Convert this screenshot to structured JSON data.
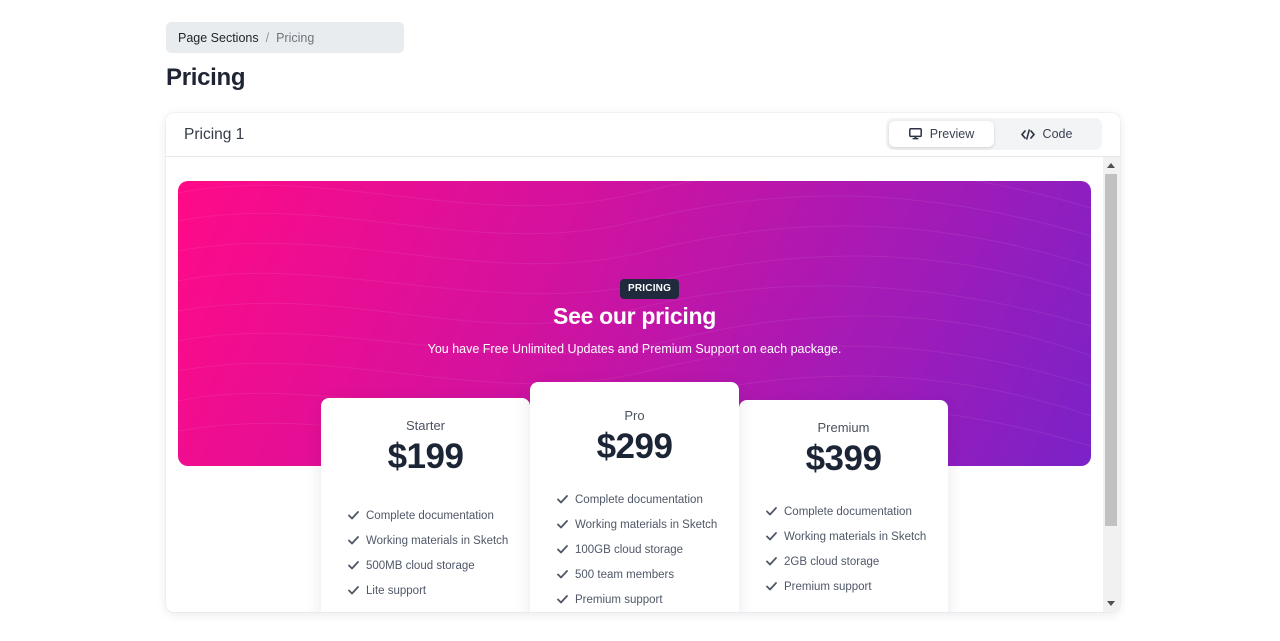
{
  "breadcrumb": {
    "parent": "Page Sections",
    "separator": "/",
    "current": "Pricing"
  },
  "page": {
    "title": "Pricing"
  },
  "card": {
    "title": "Pricing 1",
    "toggle": {
      "preview_label": "Preview",
      "preview_icon": "monitor-icon",
      "code_label": "Code",
      "code_icon": "code-icon",
      "active": "Preview"
    }
  },
  "hero": {
    "badge": "PRICING",
    "title": "See our pricing",
    "subtitle": "You have Free Unlimited Updates and Premium Support on each package.",
    "gradient_start": "#ff0a87",
    "gradient_end": "#7a22c8"
  },
  "plans": [
    {
      "name": "Starter",
      "price": "$199",
      "features": [
        "Complete documentation",
        "Working materials in Sketch",
        "500MB cloud storage",
        "Lite support"
      ]
    },
    {
      "name": "Pro",
      "price": "$299",
      "features": [
        "Complete documentation",
        "Working materials in Sketch",
        "100GB cloud storage",
        "500 team members",
        "Premium support"
      ]
    },
    {
      "name": "Premium",
      "price": "$399",
      "features": [
        "Complete documentation",
        "Working materials in Sketch",
        "2GB cloud storage",
        "Premium support"
      ]
    }
  ],
  "colors": {
    "badge_bg": "#1f2a3d",
    "price_text": "#1c2536",
    "check_icon": "#4f5767"
  }
}
